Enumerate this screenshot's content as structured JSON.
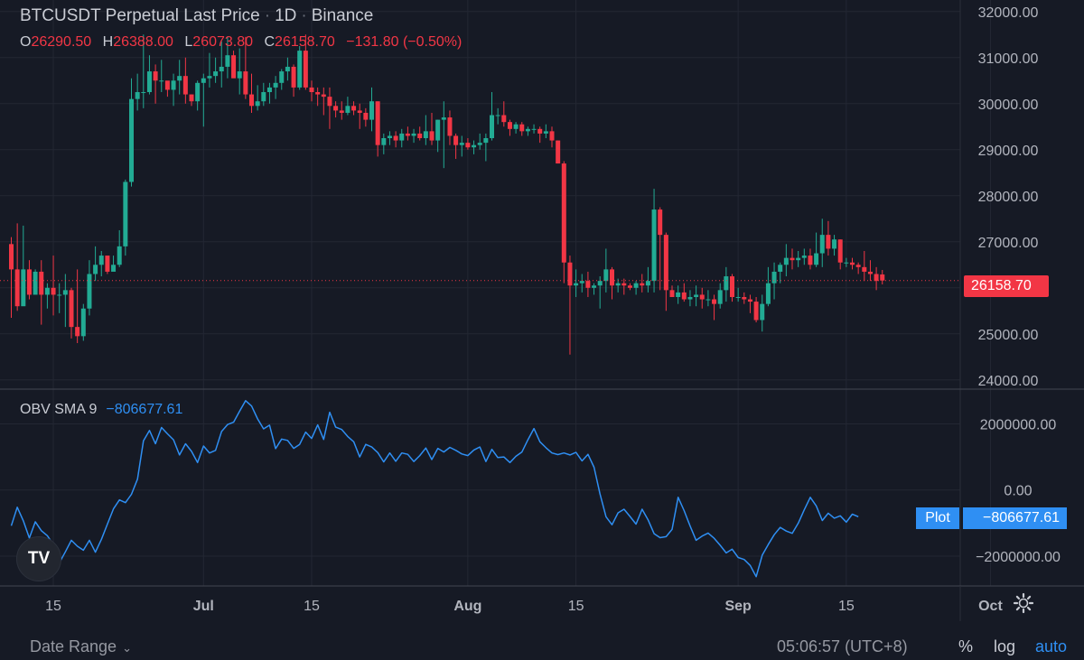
{
  "header": {
    "symbol": "BTCUSDT Perpetual Last Price",
    "interval": "1D",
    "exchange": "Binance",
    "sep": "·",
    "ohlc": {
      "o_label": "O",
      "o_value": "26290.50",
      "h_label": "H",
      "h_value": "26388.00",
      "l_label": "L",
      "l_value": "26073.80",
      "c_label": "C",
      "c_value": "26158.70",
      "change": "−131.80 (−0.50%)"
    }
  },
  "indicator": {
    "name": "OBV SMA 9",
    "value": "−806677.61",
    "plot_label": "Plot"
  },
  "price_tag": "26158.70",
  "logo_text": "TV",
  "bottom_bar": {
    "date_range": "Date Range",
    "time": "05:06:57 (UTC+8)",
    "percent": "%",
    "log": "log",
    "auto": "auto"
  },
  "icons": {
    "settings": "gear-icon",
    "date_range_chevron": "chevron-down-icon",
    "logo": "tradingview-logo-icon"
  },
  "colors": {
    "up": "#22ab94",
    "down": "#f23645",
    "obv_line": "#2f8ff3",
    "background": "#161a25",
    "grid": "#232733"
  },
  "chart_data": [
    {
      "type": "candlestick",
      "title": "BTCUSDT Perpetual Last Price · 1D · Binance",
      "x_axis_ticks": [
        "15",
        "Jul",
        "15",
        "Aug",
        "15",
        "Sep",
        "15",
        "Oct"
      ],
      "y_axis_ticks": [
        24000,
        25000,
        26000,
        27000,
        28000,
        29000,
        30000,
        31000,
        32000
      ],
      "y_axis_tick_labels": [
        "24000.00",
        "25000.00",
        "26000.00",
        "27000.00",
        "28000.00",
        "29000.00",
        "30000.00",
        "31000.00",
        "32000.00"
      ],
      "ylim": [
        23800,
        32250
      ],
      "last_price": 26158.7,
      "start_date": "2023-06-08",
      "candles": [
        [
          26950,
          27100,
          25350,
          26400
        ],
        [
          26400,
          27400,
          25500,
          25600
        ],
        [
          25600,
          27350,
          25800,
          26400
        ],
        [
          26400,
          26600,
          25750,
          25850
        ],
        [
          25850,
          26400,
          25950,
          26350
        ],
        [
          26350,
          26600,
          25200,
          25850
        ],
        [
          25850,
          26100,
          25550,
          26000
        ],
        [
          26000,
          26700,
          25400,
          25850
        ],
        [
          25850,
          26100,
          25450,
          25850
        ],
        [
          25850,
          26300,
          25150,
          25950
        ],
        [
          25950,
          26000,
          24900,
          25150
        ],
        [
          25150,
          26400,
          24800,
          24950
        ],
        [
          24950,
          25650,
          24850,
          25550
        ],
        [
          25550,
          26600,
          25400,
          26300
        ],
        [
          26300,
          26900,
          26150,
          26500
        ],
        [
          26500,
          26800,
          26250,
          26700
        ],
        [
          26700,
          26550,
          26300,
          26350
        ],
        [
          26350,
          26700,
          26450,
          26500
        ],
        [
          26500,
          27250,
          26450,
          26900
        ],
        [
          26900,
          28350,
          26700,
          28300
        ],
        [
          28300,
          30550,
          28200,
          30100
        ],
        [
          30100,
          30650,
          29850,
          30250
        ],
        [
          30250,
          31500,
          29900,
          30250
        ],
        [
          30250,
          31050,
          30200,
          30700
        ],
        [
          30700,
          30850,
          30000,
          30500
        ],
        [
          30500,
          30950,
          30250,
          30500
        ],
        [
          30500,
          30450,
          30150,
          30300
        ],
        [
          30300,
          30650,
          29950,
          30500
        ],
        [
          30500,
          30950,
          30200,
          30600
        ],
        [
          30600,
          31000,
          30000,
          30200
        ],
        [
          30200,
          30200,
          29950,
          30050
        ],
        [
          30050,
          30500,
          29850,
          30450
        ],
        [
          30450,
          30650,
          29500,
          30550
        ],
        [
          30550,
          31100,
          30350,
          30600
        ],
        [
          30600,
          31000,
          30450,
          30700
        ],
        [
          30700,
          31350,
          30350,
          30800
        ],
        [
          30800,
          31450,
          30550,
          31050
        ],
        [
          31050,
          31150,
          30700,
          30550
        ],
        [
          30550,
          31200,
          30200,
          30700
        ],
        [
          30700,
          31450,
          30100,
          30200
        ],
        [
          30200,
          30650,
          29800,
          29950
        ],
        [
          29950,
          30400,
          29850,
          30050
        ],
        [
          30050,
          30450,
          29950,
          30250
        ],
        [
          30250,
          30450,
          30000,
          30350
        ],
        [
          30350,
          30600,
          30100,
          30450
        ],
        [
          30450,
          30750,
          30300,
          30700
        ],
        [
          30700,
          31000,
          30500,
          30800
        ],
        [
          30800,
          30850,
          30150,
          30350
        ],
        [
          30350,
          31250,
          30300,
          31150
        ],
        [
          31150,
          31500,
          30300,
          30350
        ],
        [
          30350,
          30500,
          30050,
          30250
        ],
        [
          30250,
          30350,
          29950,
          30200
        ],
        [
          30200,
          30350,
          29750,
          30150
        ],
        [
          30150,
          30350,
          29450,
          29950
        ],
        [
          29950,
          30050,
          29700,
          29850
        ],
        [
          29850,
          30050,
          29650,
          29800
        ],
        [
          29800,
          30150,
          29750,
          29950
        ],
        [
          29950,
          30050,
          29750,
          29850
        ],
        [
          29850,
          30000,
          29450,
          29800
        ],
        [
          29800,
          29900,
          29500,
          29650
        ],
        [
          29650,
          30350,
          29400,
          30050
        ],
        [
          30050,
          30050,
          28850,
          29100
        ],
        [
          29100,
          29350,
          28900,
          29250
        ],
        [
          29250,
          29400,
          29100,
          29300
        ],
        [
          29300,
          29400,
          29050,
          29200
        ],
        [
          29200,
          29450,
          29050,
          29350
        ],
        [
          29350,
          29500,
          29200,
          29300
        ],
        [
          29300,
          29450,
          29150,
          29350
        ],
        [
          29350,
          29500,
          29200,
          29250
        ],
        [
          29250,
          29750,
          29100,
          29400
        ],
        [
          29400,
          29800,
          29100,
          29200
        ],
        [
          29200,
          29650,
          28950,
          29650
        ],
        [
          29650,
          30050,
          28600,
          29700
        ],
        [
          29700,
          29850,
          29100,
          29300
        ],
        [
          29300,
          29350,
          28800,
          29100
        ],
        [
          29100,
          29300,
          28850,
          29150
        ],
        [
          29150,
          29250,
          29000,
          29050
        ],
        [
          29050,
          29200,
          28900,
          29100
        ],
        [
          29100,
          29350,
          29000,
          29150
        ],
        [
          29150,
          29350,
          28750,
          29250
        ],
        [
          29250,
          30250,
          29200,
          29750
        ],
        [
          29750,
          29900,
          29550,
          29750
        ],
        [
          29750,
          30050,
          29500,
          29600
        ],
        [
          29600,
          29650,
          29300,
          29450
        ],
        [
          29450,
          29600,
          29350,
          29550
        ],
        [
          29550,
          29600,
          29300,
          29400
        ],
        [
          29400,
          29500,
          29300,
          29450
        ],
        [
          29450,
          29550,
          29350,
          29450
        ],
        [
          29450,
          29500,
          29150,
          29350
        ],
        [
          29350,
          29550,
          29250,
          29400
        ],
        [
          29400,
          29500,
          29050,
          29200
        ],
        [
          29200,
          29200,
          28700,
          28700
        ],
        [
          28700,
          28750,
          26100,
          26550
        ],
        [
          26550,
          26700,
          24550,
          26050
        ],
        [
          26050,
          26400,
          25800,
          26100
        ],
        [
          26100,
          26300,
          25900,
          26150
        ],
        [
          26150,
          26350,
          25800,
          26000
        ],
        [
          26000,
          26100,
          25850,
          26050
        ],
        [
          26050,
          26250,
          25550,
          26150
        ],
        [
          26150,
          26850,
          25900,
          26400
        ],
        [
          26400,
          26450,
          25750,
          26050
        ],
        [
          26050,
          26200,
          25900,
          26100
        ],
        [
          26100,
          26200,
          25850,
          26050
        ],
        [
          26050,
          26100,
          25950,
          26000
        ],
        [
          26000,
          26150,
          25850,
          26100
        ],
        [
          26100,
          26300,
          25900,
          26050
        ],
        [
          26050,
          26450,
          25900,
          26150
        ],
        [
          26150,
          28150,
          25900,
          27700
        ],
        [
          27700,
          27750,
          25950,
          27150
        ],
        [
          27150,
          27200,
          25500,
          25950
        ],
        [
          25950,
          26050,
          25850,
          25800
        ],
        [
          25800,
          26050,
          25650,
          25900
        ],
        [
          25900,
          26100,
          25700,
          25750
        ],
        [
          25750,
          25950,
          25600,
          25800
        ],
        [
          25800,
          26050,
          25600,
          25850
        ],
        [
          25850,
          26000,
          25550,
          25750
        ],
        [
          25750,
          25950,
          25600,
          25750
        ],
        [
          25750,
          25850,
          25300,
          25650
        ],
        [
          25650,
          26100,
          25550,
          25950
        ],
        [
          25950,
          26450,
          25700,
          26250
        ],
        [
          26250,
          26300,
          25700,
          25800
        ],
        [
          25800,
          26000,
          25700,
          25800
        ],
        [
          25800,
          25900,
          25650,
          25750
        ],
        [
          25750,
          25850,
          25450,
          25700
        ],
        [
          25700,
          25800,
          25250,
          25300
        ],
        [
          25300,
          25850,
          25050,
          25650
        ],
        [
          25650,
          26450,
          25600,
          26100
        ],
        [
          26100,
          26550,
          25750,
          26350
        ],
        [
          26350,
          26550,
          26100,
          26500
        ],
        [
          26500,
          26950,
          26250,
          26650
        ],
        [
          26650,
          26850,
          26400,
          26600
        ],
        [
          26600,
          26800,
          26450,
          26650
        ],
        [
          26650,
          26850,
          26500,
          26700
        ],
        [
          26700,
          26850,
          26400,
          26500
        ],
        [
          26500,
          27200,
          26450,
          26750
        ],
        [
          26750,
          27500,
          26450,
          27150
        ],
        [
          27150,
          27450,
          26700,
          26850
        ],
        [
          26850,
          27150,
          26700,
          27050
        ],
        [
          27050,
          27050,
          26400,
          26550
        ],
        [
          26550,
          26650,
          26450,
          26550
        ],
        [
          26550,
          26650,
          26400,
          26500
        ],
        [
          26500,
          26550,
          26300,
          26450
        ],
        [
          26450,
          26800,
          26150,
          26350
        ],
        [
          26350,
          26600,
          26150,
          26300
        ],
        [
          26300,
          26450,
          25950,
          26150
        ],
        [
          26290.5,
          26388,
          26073.8,
          26158.7
        ]
      ]
    },
    {
      "type": "line",
      "title": "OBV SMA 9",
      "y_axis_ticks": [
        -2000000,
        0,
        2000000
      ],
      "y_axis_tick_labels": [
        "−2000000.00",
        "0.00",
        "2000000.00"
      ],
      "ylim": [
        -2900000,
        3050000
      ],
      "last_value": -806677.61,
      "series": [
        {
          "name": "OBV SMA 9",
          "values": [
            -1080000,
            -520000,
            -930000,
            -1450000,
            -960000,
            -1230000,
            -1380000,
            -1650000,
            -2200000,
            -1870000,
            -1520000,
            -1700000,
            -1820000,
            -1520000,
            -1880000,
            -1490000,
            -1030000,
            -570000,
            -300000,
            -380000,
            -130000,
            330000,
            1490000,
            1800000,
            1400000,
            1890000,
            1700000,
            1520000,
            1060000,
            1400000,
            1170000,
            830000,
            1330000,
            1120000,
            1200000,
            1770000,
            1980000,
            2050000,
            2380000,
            2700000,
            2540000,
            2150000,
            1850000,
            1960000,
            1250000,
            1540000,
            1500000,
            1260000,
            1380000,
            1750000,
            1560000,
            1970000,
            1530000,
            2350000,
            1900000,
            1830000,
            1620000,
            1460000,
            1000000,
            1380000,
            1300000,
            1130000,
            850000,
            1120000,
            870000,
            1120000,
            1080000,
            860000,
            1040000,
            1270000,
            920000,
            1260000,
            1150000,
            1290000,
            1200000,
            1090000,
            1040000,
            1210000,
            1300000,
            860000,
            1230000,
            980000,
            1000000,
            830000,
            1020000,
            1150000,
            1520000,
            1860000,
            1460000,
            1280000,
            1120000,
            1070000,
            1120000,
            1060000,
            1140000,
            880000,
            1080000,
            690000,
            -120000,
            -810000,
            -1050000,
            -690000,
            -580000,
            -800000,
            -1030000,
            -580000,
            -900000,
            -1320000,
            -1440000,
            -1410000,
            -1190000,
            -220000,
            -620000,
            -1090000,
            -1520000,
            -1390000,
            -1300000,
            -1460000,
            -1670000,
            -1900000,
            -1790000,
            -2040000,
            -2100000,
            -2280000,
            -2620000,
            -1970000,
            -1650000,
            -1350000,
            -1130000,
            -1240000,
            -1310000,
            -1000000,
            -600000,
            -220000,
            -480000,
            -920000,
            -700000,
            -850000,
            -780000,
            -970000,
            -730000,
            -806677.61
          ]
        }
      ]
    }
  ]
}
